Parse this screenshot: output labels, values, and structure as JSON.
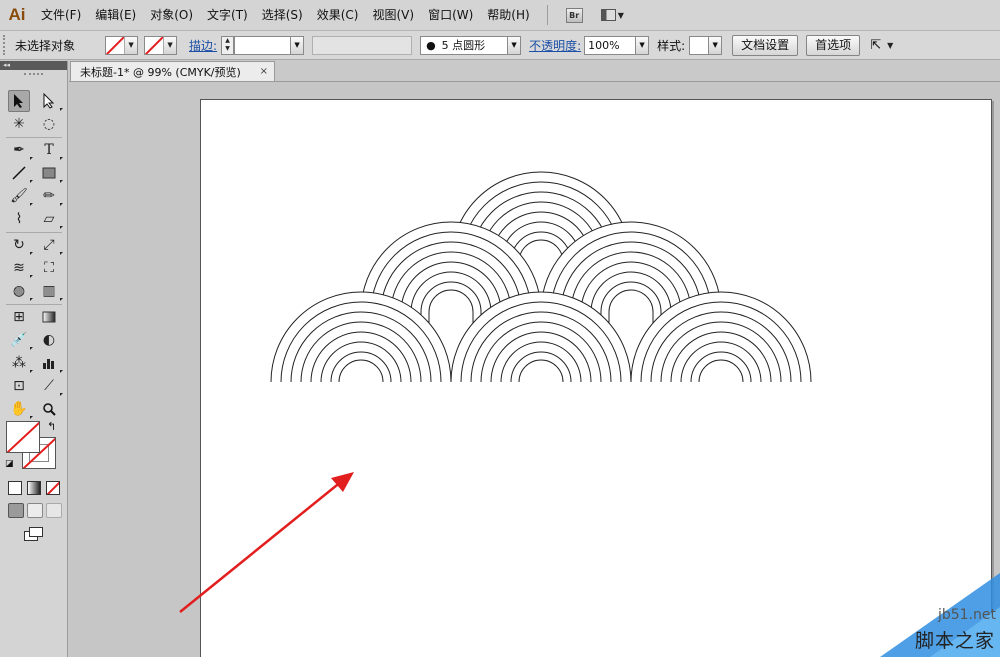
{
  "app": {
    "logo": "Ai"
  },
  "menu": {
    "items": [
      "文件(F)",
      "编辑(E)",
      "对象(O)",
      "文字(T)",
      "选择(S)",
      "效果(C)",
      "视图(V)",
      "窗口(W)",
      "帮助(H)"
    ],
    "bridge_label": "Br"
  },
  "control": {
    "selection_status": "未选择对象",
    "stroke_label": "描边:",
    "brush_value": "5 点圆形",
    "opacity_label": "不透明度:",
    "opacity_value": "100%",
    "style_label": "样式:",
    "doc_setup_button": "文档设置",
    "preferences_button": "首选项",
    "stroke_color": "#e21e1e"
  },
  "document": {
    "tab_title": "未标题-1* @ 99% (CMYK/预览)",
    "close_symbol": "×"
  },
  "tools": {
    "panel_collapse": "◂◂"
  },
  "watermark": {
    "url": "jb51.net",
    "site_name": "脚本之家"
  },
  "colors": {
    "annotation_arrow": "#e21e1e",
    "watermark_blue": "#2f8ee0"
  }
}
